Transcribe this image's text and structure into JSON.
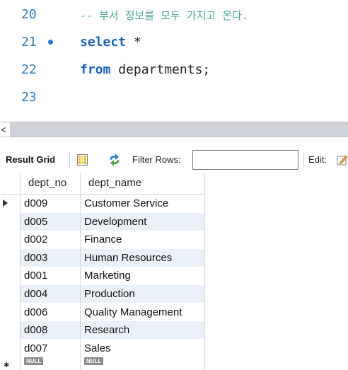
{
  "editor": {
    "lines": [
      {
        "number": "20",
        "text": "-- 부서 정보를 모두 가지고 온다.",
        "kind": "comment",
        "dot": false
      },
      {
        "number": "21",
        "text": "select *",
        "kind": "select",
        "dot": true
      },
      {
        "number": "22",
        "text": "from departments;",
        "kind": "from",
        "dot": false
      },
      {
        "number": "23",
        "text": "",
        "kind": "empty",
        "dot": false
      }
    ],
    "keyword_select": "select",
    "select_rest": " *",
    "keyword_from": "from",
    "from_rest": " departments;"
  },
  "splitter": {
    "collapse_glyph": "<"
  },
  "toolbar": {
    "result_grid_label": "Result Grid",
    "filter_rows_label": "Filter Rows:",
    "filter_value": "",
    "edit_label": "Edit:",
    "icons": [
      "grid-layout-icon",
      "refresh-icon",
      "edit-icon"
    ]
  },
  "grid": {
    "columns": [
      "dept_no",
      "dept_name"
    ],
    "rows": [
      [
        "d009",
        "Customer Service"
      ],
      [
        "d005",
        "Development"
      ],
      [
        "d002",
        "Finance"
      ],
      [
        "d003",
        "Human Resources"
      ],
      [
        "d001",
        "Marketing"
      ],
      [
        "d004",
        "Production"
      ],
      [
        "d006",
        "Quality Management"
      ],
      [
        "d008",
        "Research"
      ],
      [
        "d007",
        "Sales"
      ]
    ],
    "null_label": "NULL",
    "alt_row_color": "#eaf0f8"
  }
}
